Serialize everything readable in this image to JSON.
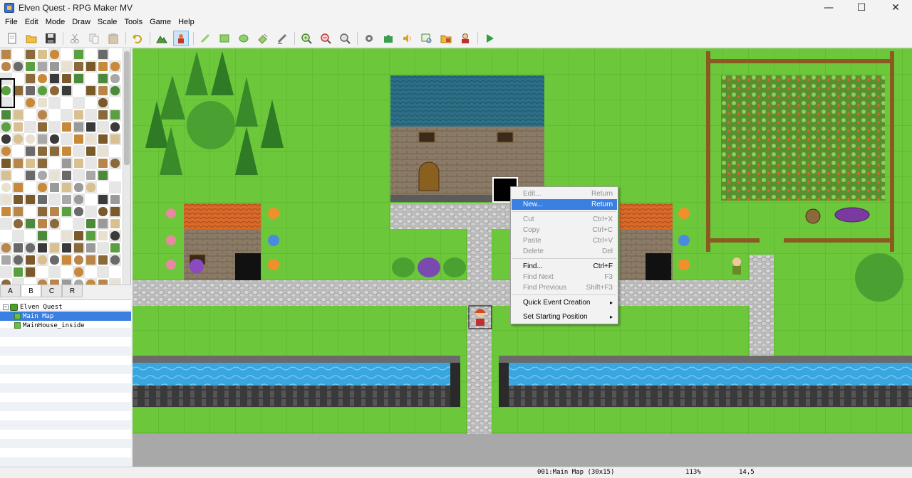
{
  "window": {
    "title": "Elven Quest - RPG Maker MV",
    "minimize_glyph": "—",
    "maximize_glyph": "☐",
    "close_glyph": "✕"
  },
  "menu": [
    "File",
    "Edit",
    "Mode",
    "Draw",
    "Scale",
    "Tools",
    "Game",
    "Help"
  ],
  "toolbar": {
    "buttons": [
      {
        "name": "new-project-icon"
      },
      {
        "name": "open-project-icon"
      },
      {
        "name": "save-project-icon"
      },
      {
        "name": "cut-icon"
      },
      {
        "name": "copy-icon"
      },
      {
        "name": "paste-icon"
      },
      {
        "name": "undo-icon"
      },
      {
        "name": "map-mode-icon"
      },
      {
        "name": "event-mode-icon"
      },
      {
        "name": "pencil-icon"
      },
      {
        "name": "rectangle-icon"
      },
      {
        "name": "ellipse-icon"
      },
      {
        "name": "flood-fill-icon"
      },
      {
        "name": "shadow-pen-icon"
      },
      {
        "name": "zoom-in-icon"
      },
      {
        "name": "zoom-out-icon"
      },
      {
        "name": "actual-size-icon"
      },
      {
        "name": "database-icon"
      },
      {
        "name": "plugin-manager-icon"
      },
      {
        "name": "sound-test-icon"
      },
      {
        "name": "event-searcher-icon"
      },
      {
        "name": "resource-manager-icon"
      },
      {
        "name": "character-generator-icon"
      },
      {
        "name": "playtest-icon"
      }
    ],
    "active": "event-mode-icon"
  },
  "tileset_tabs": {
    "items": [
      "A",
      "B",
      "C",
      "R"
    ],
    "selected": "B"
  },
  "map_tree": {
    "items": [
      {
        "label": "Elven Quest",
        "type": "project"
      },
      {
        "label": "Main Map",
        "type": "map",
        "selected": true
      },
      {
        "label": "MainHouse_inside",
        "type": "map"
      }
    ]
  },
  "context_menu": {
    "items": [
      {
        "label": "Edit...",
        "shortcut": "Return",
        "disabled": true
      },
      {
        "label": "New...",
        "shortcut": "Return",
        "highlighted": true
      },
      {
        "label": "Cut",
        "shortcut": "Ctrl+X",
        "disabled": true
      },
      {
        "label": "Copy",
        "shortcut": "Ctrl+C",
        "disabled": true
      },
      {
        "label": "Paste",
        "shortcut": "Ctrl+V",
        "disabled": true
      },
      {
        "label": "Delete",
        "shortcut": "Del",
        "disabled": true
      },
      {
        "label": "Find...",
        "shortcut": "Ctrl+F"
      },
      {
        "label": "Find Next",
        "shortcut": "F3",
        "disabled": true
      },
      {
        "label": "Find Previous",
        "shortcut": "Shift+F3",
        "disabled": true
      },
      {
        "label": "Quick Event Creation",
        "shortcut": "▸"
      },
      {
        "label": "Set Starting Position",
        "shortcut": "▸"
      }
    ]
  },
  "status": {
    "map_info": "001:Main Map (30x15)",
    "zoom": "113%",
    "coords": "14,5"
  },
  "colors": {
    "grass": "#6cc83a",
    "path": "#c8c8c8",
    "water": "#3aa6e0",
    "roof_blue": "#2d6f86",
    "roof_orange": "#d96a2a",
    "wall_stone": "#8a7a66",
    "selection": "#3b7fe0"
  }
}
